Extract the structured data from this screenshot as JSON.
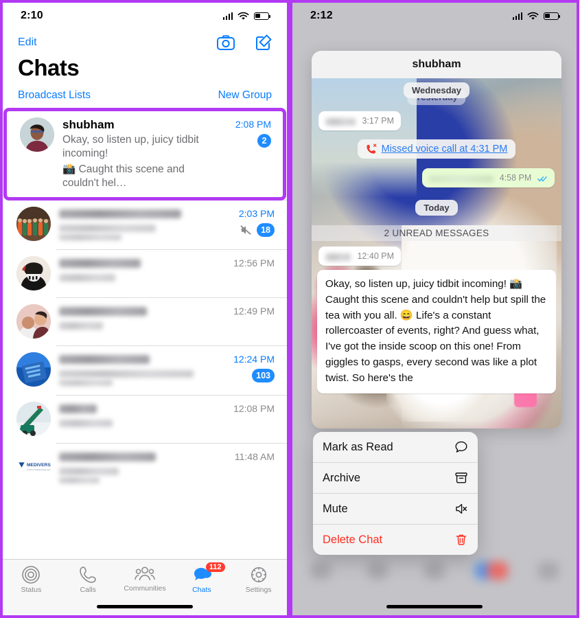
{
  "meta": {
    "accent_purple": "#b23af2",
    "ios_blue": "#087cfd",
    "badge_blue": "#1f8cff",
    "badge_red": "#ff3b30",
    "danger_red": "#ff2d21"
  },
  "left_phone": {
    "status_bar": {
      "time": "2:10"
    },
    "nav": {
      "edit_label": "Edit",
      "camera_icon": "camera-icon",
      "compose_icon": "compose-icon",
      "title": "Chats",
      "broadcast_label": "Broadcast Lists",
      "new_group_label": "New Group"
    },
    "chats": [
      {
        "name": "shubham",
        "snippet_line1": "Okay, so listen up, juicy tidbit incoming!",
        "snippet_line2": "📸 Caught this scene and couldn't hel…",
        "time": "2:08 PM",
        "time_blue": true,
        "badge": "2",
        "muted": false,
        "highlighted": true,
        "redacted": false
      },
      {
        "name": "",
        "snippet_line1": "",
        "snippet_line2": "",
        "time": "2:03 PM",
        "time_blue": true,
        "badge": "18",
        "muted": true,
        "highlighted": false,
        "redacted": true
      },
      {
        "name": "",
        "snippet_line1": "",
        "snippet_line2": "",
        "time": "12:56 PM",
        "time_blue": false,
        "badge": "",
        "muted": false,
        "highlighted": false,
        "redacted": true
      },
      {
        "name": "",
        "snippet_line1": "",
        "snippet_line2": "",
        "time": "12:49 PM",
        "time_blue": false,
        "badge": "",
        "muted": false,
        "highlighted": false,
        "redacted": true
      },
      {
        "name": "",
        "snippet_line1": "",
        "snippet_line2": "",
        "time": "12:24 PM",
        "time_blue": true,
        "badge": "103",
        "muted": false,
        "highlighted": false,
        "redacted": true
      },
      {
        "name": "",
        "snippet_line1": "",
        "snippet_line2": "",
        "time": "12:08 PM",
        "time_blue": false,
        "badge": "",
        "muted": false,
        "highlighted": false,
        "redacted": true
      },
      {
        "name": "",
        "snippet_line1": "",
        "snippet_line2": "",
        "time": "11:48 AM",
        "time_blue": false,
        "badge": "",
        "muted": false,
        "highlighted": false,
        "redacted": true
      }
    ],
    "tabbar": {
      "tabs": [
        {
          "label": "Status",
          "icon": "status-rings-icon",
          "active": false,
          "badge": ""
        },
        {
          "label": "Calls",
          "icon": "phone-icon",
          "active": false,
          "badge": ""
        },
        {
          "label": "Communities",
          "icon": "communities-icon",
          "active": false,
          "badge": ""
        },
        {
          "label": "Chats",
          "icon": "chats-bubble-icon",
          "active": true,
          "badge": "112"
        },
        {
          "label": "Settings",
          "icon": "gear-icon",
          "active": false,
          "badge": ""
        }
      ]
    }
  },
  "right_phone": {
    "status_bar": {
      "time": "2:12"
    },
    "chat": {
      "contact_name": "shubham",
      "day_divider_top": "Wednesday",
      "day_divider_behind": "Yesterday",
      "day_divider_today": "Today",
      "unread_divider": "2 UNREAD MESSAGES",
      "messages": [
        {
          "kind": "incoming-redacted",
          "time": "3:17 PM",
          "text": ""
        },
        {
          "kind": "missed-call",
          "text": "Missed voice call at 4:31 PM",
          "icon": "missed-call-icon"
        },
        {
          "kind": "outgoing-redacted",
          "time": "4:58 PM",
          "text": "",
          "ticks": "read-ticks-icon"
        },
        {
          "kind": "incoming-redacted",
          "time": "12:40 PM",
          "text": ""
        },
        {
          "kind": "incoming-long",
          "text": "Okay, so listen up, juicy tidbit incoming! 📸 Caught this scene and couldn't help but spill the tea with you all. 😄 Life's a constant rollercoaster of events, right? And guess what, I've got the inside scoop on this one! From giggles to gasps, every second was like a plot twist. So here's the"
        }
      ]
    },
    "context_menu": {
      "items": [
        {
          "label": "Mark as Read",
          "icon": "chat-bubble-icon",
          "danger": false
        },
        {
          "label": "Archive",
          "icon": "archive-box-icon",
          "danger": false
        },
        {
          "label": "Mute",
          "icon": "mute-speaker-icon",
          "danger": false
        },
        {
          "label": "Delete Chat",
          "icon": "trash-icon",
          "danger": true
        }
      ]
    }
  }
}
